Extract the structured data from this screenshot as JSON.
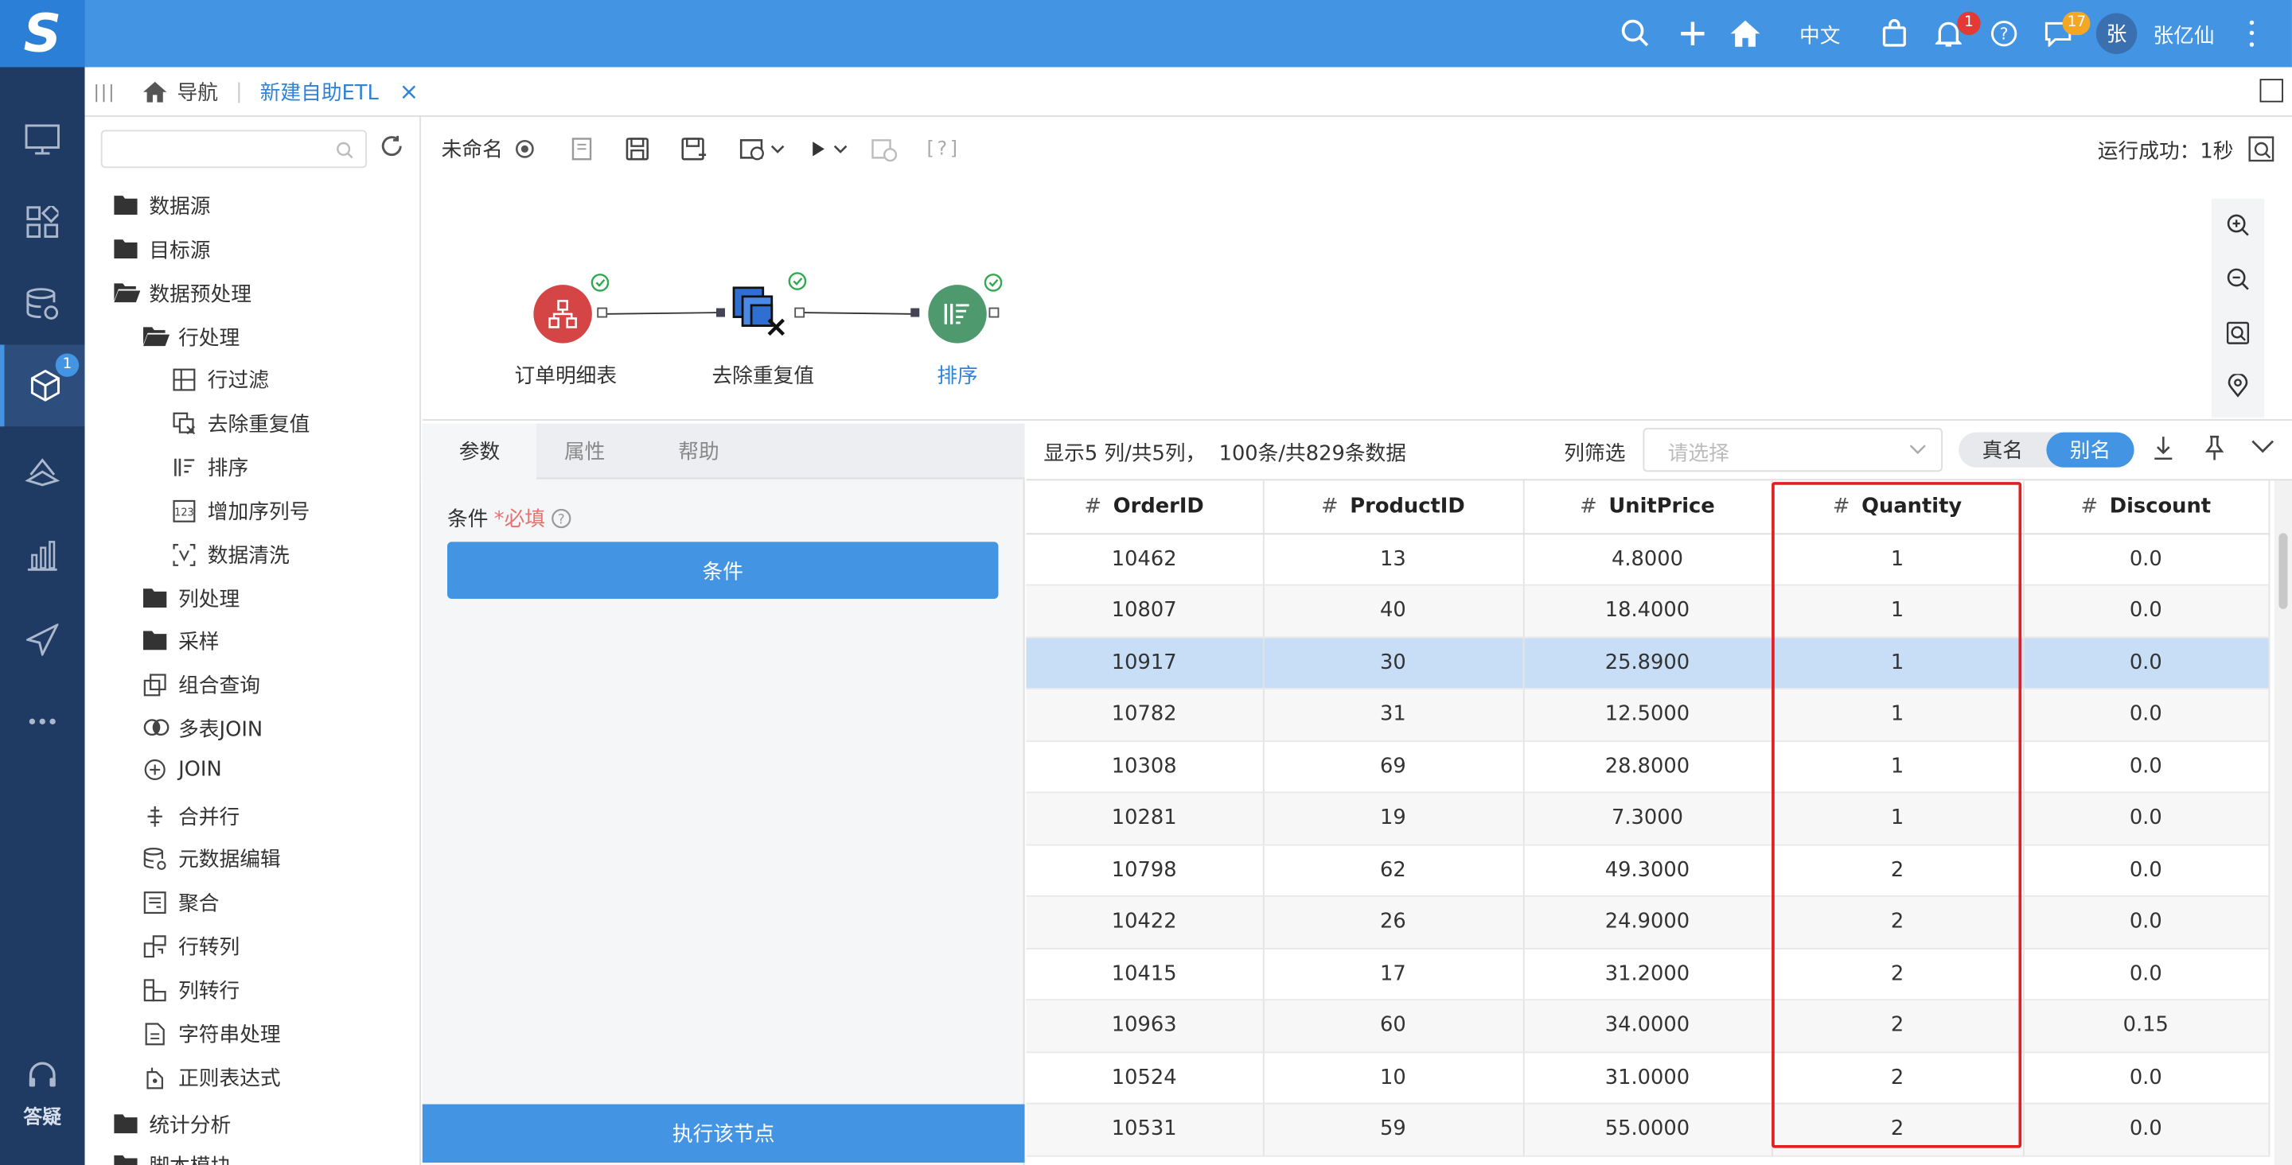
{
  "topbar": {
    "logo_text": "S",
    "language": "中文",
    "notify_count": "1",
    "message_count": "17",
    "avatar_text": "张",
    "username": "张亿仙",
    "accent": "#4494e4"
  },
  "leftnav": {
    "badge": "1",
    "help_label": "答疑"
  },
  "breadcrumb": {
    "home_label": "导航",
    "active_tab": "新建自助ETL",
    "close": "×"
  },
  "tree": {
    "search_placeholder": "",
    "items": [
      {
        "label": "数据源"
      },
      {
        "label": "目标源"
      },
      {
        "label": "数据预处理"
      },
      {
        "label": "行处理"
      },
      {
        "label": "行过滤"
      },
      {
        "label": "去除重复值"
      },
      {
        "label": "排序"
      },
      {
        "label": "增加序列号"
      },
      {
        "label": "数据清洗"
      },
      {
        "label": "列处理"
      },
      {
        "label": "采样"
      },
      {
        "label": "组合查询"
      },
      {
        "label": "多表JOIN"
      },
      {
        "label": "JOIN"
      },
      {
        "label": "合并行"
      },
      {
        "label": "元数据编辑"
      },
      {
        "label": "聚合"
      },
      {
        "label": "行转列"
      },
      {
        "label": "列转行"
      },
      {
        "label": "字符串处理"
      },
      {
        "label": "正则表达式"
      },
      {
        "label": "统计分析"
      },
      {
        "label": "脚本模块"
      }
    ]
  },
  "toolbar": {
    "name": "未命名",
    "help_bracket": "[?]",
    "run_status": "运行成功：1秒"
  },
  "flow": {
    "nodes": [
      {
        "label": "订单明细表",
        "color": "#d64545"
      },
      {
        "label": "去除重复值",
        "color": "#2f6fd1"
      },
      {
        "label": "排序",
        "color": "#4e9a6e"
      }
    ]
  },
  "params": {
    "tabs": [
      "参数",
      "属性",
      "帮助"
    ],
    "condition_label": "条件",
    "required_label": "*必填",
    "condition_button": "条件",
    "execute_button": "执行该节点"
  },
  "datapanel": {
    "summary": "显示5 列/共5列，  100条/共829条数据",
    "filter_label": "列筛选",
    "filter_placeholder": "请选择",
    "toggle_real": "真名",
    "toggle_alias": "别名",
    "columns": [
      "OrderID",
      "ProductID",
      "UnitPrice",
      "Quantity",
      "Discount"
    ],
    "rows": [
      [
        "10462",
        "13",
        "4.8000",
        "1",
        "0.0"
      ],
      [
        "10807",
        "40",
        "18.4000",
        "1",
        "0.0"
      ],
      [
        "10917",
        "30",
        "25.8900",
        "1",
        "0.0"
      ],
      [
        "10782",
        "31",
        "12.5000",
        "1",
        "0.0"
      ],
      [
        "10308",
        "69",
        "28.8000",
        "1",
        "0.0"
      ],
      [
        "10281",
        "19",
        "7.3000",
        "1",
        "0.0"
      ],
      [
        "10798",
        "62",
        "49.3000",
        "2",
        "0.0"
      ],
      [
        "10422",
        "26",
        "24.9000",
        "2",
        "0.0"
      ],
      [
        "10415",
        "17",
        "31.2000",
        "2",
        "0.0"
      ],
      [
        "10963",
        "60",
        "34.0000",
        "2",
        "0.15"
      ],
      [
        "10524",
        "10",
        "31.0000",
        "2",
        "0.0"
      ],
      [
        "10531",
        "59",
        "55.0000",
        "2",
        "0.0"
      ]
    ],
    "selected_row": 2,
    "highlight_color": "#e02020"
  }
}
